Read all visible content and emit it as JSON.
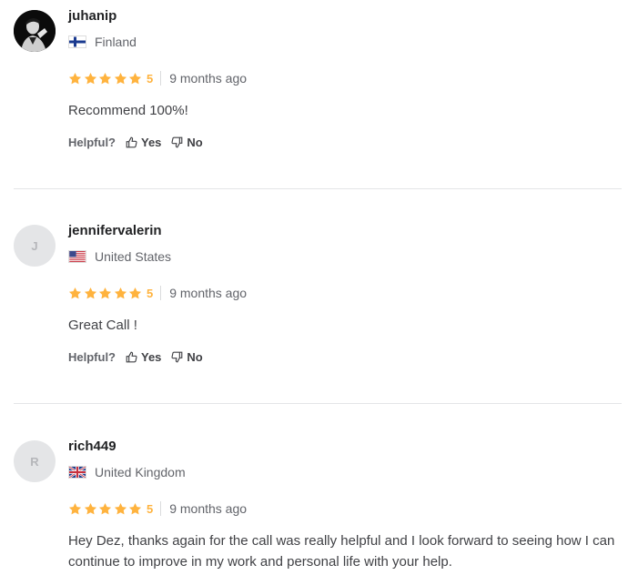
{
  "reviews": [
    {
      "username": "juhanip",
      "avatar_type": "photo",
      "avatar_initial": "",
      "country": "Finland",
      "flag": "finland-flag",
      "rating": "5",
      "stars": 5,
      "time": "9 months ago",
      "text": "Recommend 100%!",
      "helpful_label": "Helpful?",
      "yes_label": "Yes",
      "no_label": "No"
    },
    {
      "username": "jennifervalerin",
      "avatar_type": "initial",
      "avatar_initial": "J",
      "country": "United States",
      "flag": "us-flag",
      "rating": "5",
      "stars": 5,
      "time": "9 months ago",
      "text": "Great Call !",
      "helpful_label": "Helpful?",
      "yes_label": "Yes",
      "no_label": "No"
    },
    {
      "username": "rich449",
      "avatar_type": "initial",
      "avatar_initial": "R",
      "country": "United Kingdom",
      "flag": "uk-flag",
      "rating": "5",
      "stars": 5,
      "time": "9 months ago",
      "text": "Hey Dez, thanks again for the call was really helpful and I look forward to seeing how I can continue to improve in my work and personal life with your help.",
      "helpful_label": "",
      "yes_label": "",
      "no_label": ""
    }
  ],
  "colors": {
    "star": "#ffb33e",
    "divider": "#e4e5e7",
    "text": "#404145",
    "muted": "#62646a"
  }
}
